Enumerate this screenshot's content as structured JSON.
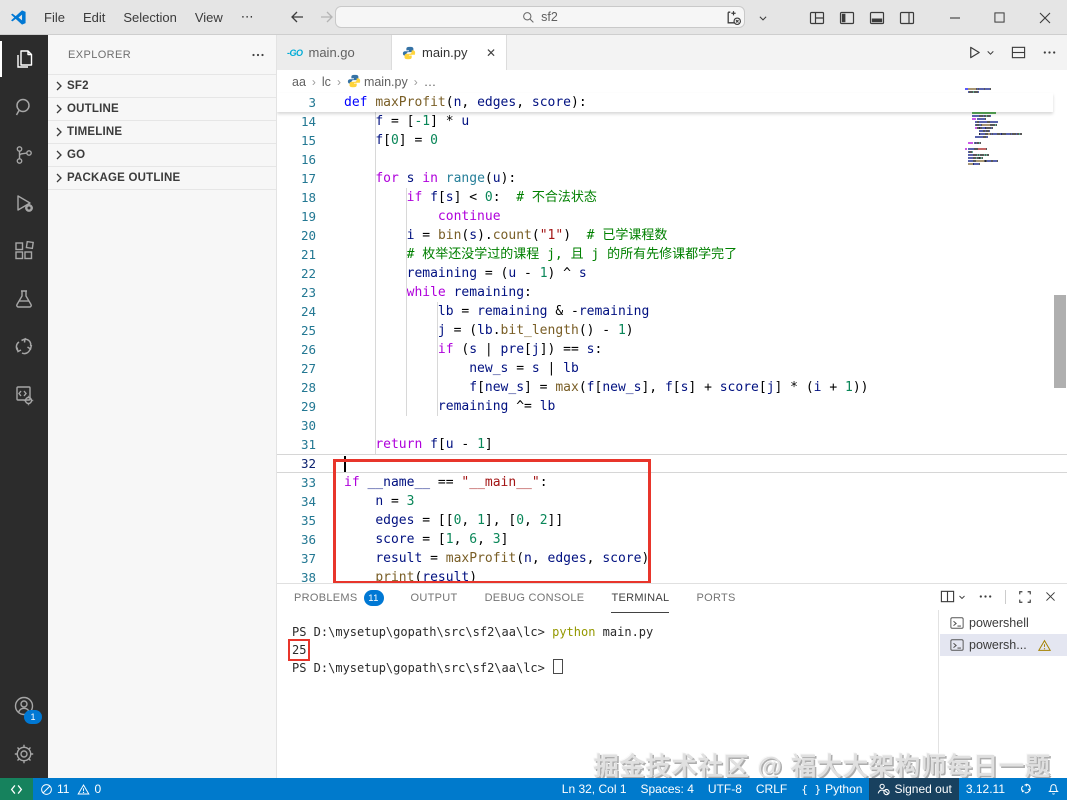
{
  "titlebar": {
    "menus": [
      "File",
      "Edit",
      "Selection",
      "View"
    ],
    "more_label": "⋯",
    "search_value": "sf2"
  },
  "activity_bar": {
    "items": [
      "explorer",
      "search",
      "source-control",
      "run-and-debug",
      "extensions",
      "testing",
      "go",
      "run-settings"
    ],
    "account_badge": "1"
  },
  "sidebar": {
    "header": "EXPLORER",
    "sections": [
      "SF2",
      "OUTLINE",
      "TIMELINE",
      "GO",
      "PACKAGE OUTLINE"
    ]
  },
  "tabs": [
    {
      "label": "main.go",
      "icon": "go",
      "active": false
    },
    {
      "label": "main.py",
      "icon": "python",
      "active": true
    }
  ],
  "breadcrumbs": [
    "aa",
    "lc",
    "main.py",
    "…"
  ],
  "editor": {
    "token_colors": {
      "k": "#AF00DB",
      "b": "#0000FF",
      "f": "#795E26",
      "c": "#267F99",
      "v": "#001080",
      "n": "#098658",
      "s": "#A31515",
      "m": "#008000",
      "o": "#000000"
    },
    "sticky_line": {
      "n": 3,
      "t": [
        [
          "def ",
          "b"
        ],
        [
          "maxProfit",
          "f"
        ],
        [
          "(",
          "o"
        ],
        [
          "n",
          "v"
        ],
        [
          ", ",
          "o"
        ],
        [
          "edges",
          "v"
        ],
        [
          ", ",
          "o"
        ],
        [
          "score",
          "v"
        ],
        [
          "):",
          "o"
        ]
      ]
    },
    "cursor_line": 32,
    "lines": [
      {
        "n": 14,
        "t": [
          [
            "    ",
            "o"
          ],
          [
            "f",
            "v"
          ],
          [
            " = [",
            "o"
          ],
          [
            "-1",
            "n"
          ],
          [
            "] * ",
            "o"
          ],
          [
            "u",
            "v"
          ]
        ]
      },
      {
        "n": 15,
        "t": [
          [
            "    ",
            "o"
          ],
          [
            "f",
            "v"
          ],
          [
            "[",
            "o"
          ],
          [
            "0",
            "n"
          ],
          [
            "] = ",
            "o"
          ],
          [
            "0",
            "n"
          ]
        ]
      },
      {
        "n": 16,
        "t": []
      },
      {
        "n": 17,
        "t": [
          [
            "    ",
            "o"
          ],
          [
            "for",
            "k"
          ],
          [
            " ",
            "o"
          ],
          [
            "s",
            "v"
          ],
          [
            " ",
            "o"
          ],
          [
            "in",
            "k"
          ],
          [
            " ",
            "o"
          ],
          [
            "range",
            "c"
          ],
          [
            "(",
            "o"
          ],
          [
            "u",
            "v"
          ],
          [
            "):",
            "o"
          ]
        ]
      },
      {
        "n": 18,
        "t": [
          [
            "        ",
            "o"
          ],
          [
            "if",
            "k"
          ],
          [
            " ",
            "o"
          ],
          [
            "f",
            "v"
          ],
          [
            "[",
            "o"
          ],
          [
            "s",
            "v"
          ],
          [
            "] < ",
            "o"
          ],
          [
            "0",
            "n"
          ],
          [
            ":",
            "o"
          ],
          [
            "  # 不合法状态",
            "m"
          ]
        ]
      },
      {
        "n": 19,
        "t": [
          [
            "            ",
            "o"
          ],
          [
            "continue",
            "k"
          ]
        ]
      },
      {
        "n": 20,
        "t": [
          [
            "        ",
            "o"
          ],
          [
            "i",
            "v"
          ],
          [
            " = ",
            "o"
          ],
          [
            "bin",
            "f"
          ],
          [
            "(",
            "o"
          ],
          [
            "s",
            "v"
          ],
          [
            ").",
            "o"
          ],
          [
            "count",
            "f"
          ],
          [
            "(",
            "o"
          ],
          [
            "\"1\"",
            "s"
          ],
          [
            ")",
            "o"
          ],
          [
            "  # 已学课程数",
            "m"
          ]
        ]
      },
      {
        "n": 21,
        "t": [
          [
            "        ",
            "o"
          ],
          [
            "# 枚举还没学过的课程 j, 且 j 的所有先修课都学完了",
            "m"
          ]
        ]
      },
      {
        "n": 22,
        "t": [
          [
            "        ",
            "o"
          ],
          [
            "remaining",
            "v"
          ],
          [
            " = (",
            "o"
          ],
          [
            "u",
            "v"
          ],
          [
            " - ",
            "o"
          ],
          [
            "1",
            "n"
          ],
          [
            ") ^ ",
            "o"
          ],
          [
            "s",
            "v"
          ]
        ]
      },
      {
        "n": 23,
        "t": [
          [
            "        ",
            "o"
          ],
          [
            "while",
            "k"
          ],
          [
            " ",
            "o"
          ],
          [
            "remaining",
            "v"
          ],
          [
            ":",
            "o"
          ]
        ]
      },
      {
        "n": 24,
        "t": [
          [
            "            ",
            "o"
          ],
          [
            "lb",
            "v"
          ],
          [
            " = ",
            "o"
          ],
          [
            "remaining",
            "v"
          ],
          [
            " & -",
            "o"
          ],
          [
            "remaining",
            "v"
          ]
        ]
      },
      {
        "n": 25,
        "t": [
          [
            "            ",
            "o"
          ],
          [
            "j",
            "v"
          ],
          [
            " = (",
            "o"
          ],
          [
            "lb",
            "v"
          ],
          [
            ".",
            "o"
          ],
          [
            "bit_length",
            "f"
          ],
          [
            "() - ",
            "o"
          ],
          [
            "1",
            "n"
          ],
          [
            ")",
            "o"
          ]
        ]
      },
      {
        "n": 26,
        "t": [
          [
            "            ",
            "o"
          ],
          [
            "if",
            "k"
          ],
          [
            " (",
            "o"
          ],
          [
            "s",
            "v"
          ],
          [
            " | ",
            "o"
          ],
          [
            "pre",
            "v"
          ],
          [
            "[",
            "o"
          ],
          [
            "j",
            "v"
          ],
          [
            "]) == ",
            "o"
          ],
          [
            "s",
            "v"
          ],
          [
            ":",
            "o"
          ]
        ]
      },
      {
        "n": 27,
        "t": [
          [
            "                ",
            "o"
          ],
          [
            "new_s",
            "v"
          ],
          [
            " = ",
            "o"
          ],
          [
            "s",
            "v"
          ],
          [
            " | ",
            "o"
          ],
          [
            "lb",
            "v"
          ]
        ]
      },
      {
        "n": 28,
        "t": [
          [
            "                ",
            "o"
          ],
          [
            "f",
            "v"
          ],
          [
            "[",
            "o"
          ],
          [
            "new_s",
            "v"
          ],
          [
            "] = ",
            "o"
          ],
          [
            "max",
            "f"
          ],
          [
            "(",
            "o"
          ],
          [
            "f",
            "v"
          ],
          [
            "[",
            "o"
          ],
          [
            "new_s",
            "v"
          ],
          [
            "], ",
            "o"
          ],
          [
            "f",
            "v"
          ],
          [
            "[",
            "o"
          ],
          [
            "s",
            "v"
          ],
          [
            "] + ",
            "o"
          ],
          [
            "score",
            "v"
          ],
          [
            "[",
            "o"
          ],
          [
            "j",
            "v"
          ],
          [
            "] * (",
            "o"
          ],
          [
            "i",
            "v"
          ],
          [
            " + ",
            "o"
          ],
          [
            "1",
            "n"
          ],
          [
            "))",
            "o"
          ]
        ]
      },
      {
        "n": 29,
        "t": [
          [
            "            ",
            "o"
          ],
          [
            "remaining",
            "v"
          ],
          [
            " ^= ",
            "o"
          ],
          [
            "lb",
            "v"
          ]
        ]
      },
      {
        "n": 30,
        "t": []
      },
      {
        "n": 31,
        "t": [
          [
            "    ",
            "o"
          ],
          [
            "return",
            "k"
          ],
          [
            " ",
            "o"
          ],
          [
            "f",
            "v"
          ],
          [
            "[",
            "o"
          ],
          [
            "u",
            "v"
          ],
          [
            " - ",
            "o"
          ],
          [
            "1",
            "n"
          ],
          [
            "]",
            "o"
          ]
        ]
      },
      {
        "n": 32,
        "t": []
      },
      {
        "n": 33,
        "t": [
          [
            "if",
            "k"
          ],
          [
            " ",
            "o"
          ],
          [
            "__name__",
            "v"
          ],
          [
            " == ",
            "o"
          ],
          [
            "\"__main__\"",
            "s"
          ],
          [
            ":",
            "o"
          ]
        ]
      },
      {
        "n": 34,
        "t": [
          [
            "    ",
            "o"
          ],
          [
            "n",
            "v"
          ],
          [
            " = ",
            "o"
          ],
          [
            "3",
            "n"
          ]
        ]
      },
      {
        "n": 35,
        "t": [
          [
            "    ",
            "o"
          ],
          [
            "edges",
            "v"
          ],
          [
            " = [[",
            "o"
          ],
          [
            "0",
            "n"
          ],
          [
            ", ",
            "o"
          ],
          [
            "1",
            "n"
          ],
          [
            "], [",
            "o"
          ],
          [
            "0",
            "n"
          ],
          [
            ", ",
            "o"
          ],
          [
            "2",
            "n"
          ],
          [
            "]]",
            "o"
          ]
        ]
      },
      {
        "n": 36,
        "t": [
          [
            "    ",
            "o"
          ],
          [
            "score",
            "v"
          ],
          [
            " = [",
            "o"
          ],
          [
            "1",
            "n"
          ],
          [
            ", ",
            "o"
          ],
          [
            "6",
            "n"
          ],
          [
            ", ",
            "o"
          ],
          [
            "3",
            "n"
          ],
          [
            "]",
            "o"
          ]
        ]
      },
      {
        "n": 37,
        "t": [
          [
            "    ",
            "o"
          ],
          [
            "result",
            "v"
          ],
          [
            " = ",
            "o"
          ],
          [
            "maxProfit",
            "f"
          ],
          [
            "(",
            "o"
          ],
          [
            "n",
            "v"
          ],
          [
            ", ",
            "o"
          ],
          [
            "edges",
            "v"
          ],
          [
            ", ",
            "o"
          ],
          [
            "score",
            "v"
          ],
          [
            ")",
            "o"
          ]
        ]
      },
      {
        "n": 38,
        "t": [
          [
            "    ",
            "o"
          ],
          [
            "print",
            "f"
          ],
          [
            "(",
            "o"
          ],
          [
            "result",
            "v"
          ],
          [
            ")",
            "o"
          ]
        ]
      }
    ]
  },
  "panel": {
    "tabs": [
      {
        "label": "PROBLEMS",
        "badge": "11",
        "active": false
      },
      {
        "label": "OUTPUT",
        "active": false
      },
      {
        "label": "DEBUG CONSOLE",
        "active": false
      },
      {
        "label": "TERMINAL",
        "active": true
      },
      {
        "label": "PORTS",
        "active": false
      }
    ],
    "terminal_colors": {
      "p": "#2A2A2A",
      "y": "#949800"
    },
    "terminal_lines": [
      {
        "t": [
          [
            "PS D:\\mysetup\\gopath\\src\\sf2\\aa\\lc> ",
            "p"
          ],
          [
            "python",
            "y"
          ],
          [
            " main.py",
            "p"
          ]
        ]
      },
      {
        "t": [
          [
            "25",
            "p"
          ]
        ],
        "boxed": true
      },
      {
        "t": [
          [
            "PS D:\\mysetup\\gopath\\src\\sf2\\aa\\lc> ",
            "p"
          ]
        ],
        "cursor": true
      }
    ],
    "terminal_list": [
      {
        "label": "powershell",
        "selected": false,
        "warning": false
      },
      {
        "label": "powersh...",
        "selected": true,
        "warning": true
      }
    ]
  },
  "watermark": "掘金技术社区 @ 福大大架构师每日一题",
  "status_bar": {
    "errors": "11",
    "warnings": "0",
    "right_items": [
      {
        "name": "cursor-position",
        "label": "Ln 32, Col 1",
        "icon": ""
      },
      {
        "name": "indentation",
        "label": "Spaces: 4",
        "icon": ""
      },
      {
        "name": "encoding",
        "label": "UTF-8",
        "icon": ""
      },
      {
        "name": "eol",
        "label": "CRLF",
        "icon": ""
      },
      {
        "name": "language-mode",
        "label": "Python",
        "icon": "brackets"
      },
      {
        "name": "accounts-signed-out",
        "label": "Signed out",
        "icon": "person-slash",
        "dark": true
      },
      {
        "name": "python-version",
        "label": "3.12.11",
        "icon": ""
      },
      {
        "name": "python-environments",
        "label": "",
        "icon": "swirl"
      },
      {
        "name": "notifications",
        "label": "",
        "icon": "bell"
      }
    ]
  }
}
